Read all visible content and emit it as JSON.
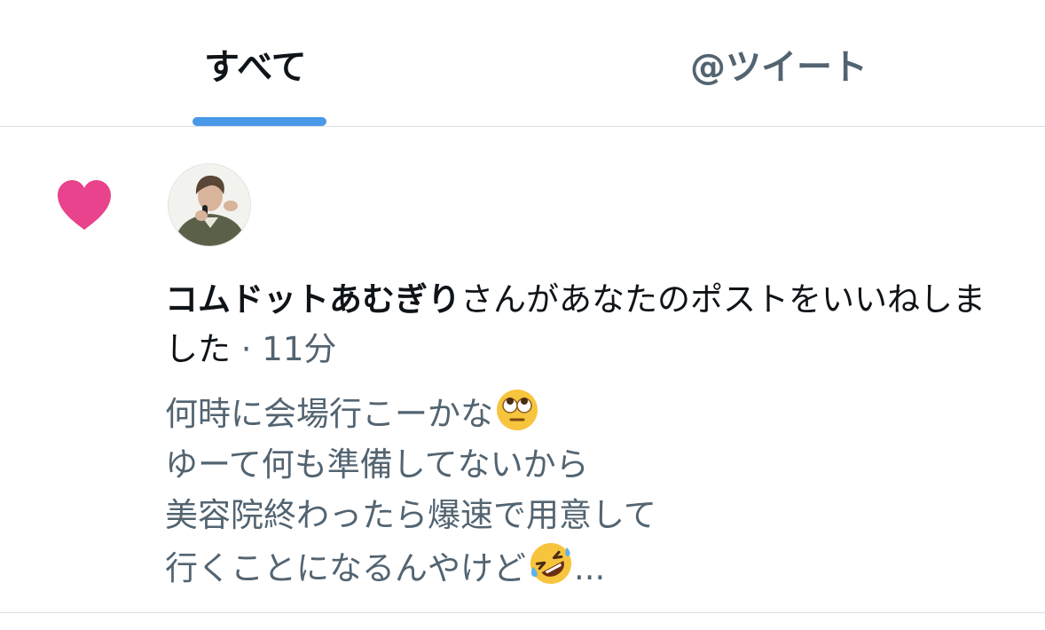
{
  "tabs": {
    "all_label": "すべて",
    "mentions_label": "@ツイート",
    "active": "すべて"
  },
  "colors": {
    "like": "#e8438c",
    "tab_indicator": "#4a99e9",
    "muted_text": "#536471"
  },
  "notification": {
    "type_icon": "heart-icon",
    "avatar_icon": "user-avatar",
    "user_name": "コムドットあむぎり",
    "action_text": "さんがあなたのポストをいいねしました",
    "separator": " · ",
    "time": "11分",
    "post_lines": [
      "何時に会場行こーかな",
      "ゆーて何も準備してないから",
      "美容院終わったら爆速で用意して",
      "行くことになるんやけど"
    ],
    "post_line1_emoji": "face-with-rolling-eyes-emoji",
    "post_line4_emoji": "rolling-on-the-floor-laughing-emoji",
    "post_truncation": "..."
  }
}
